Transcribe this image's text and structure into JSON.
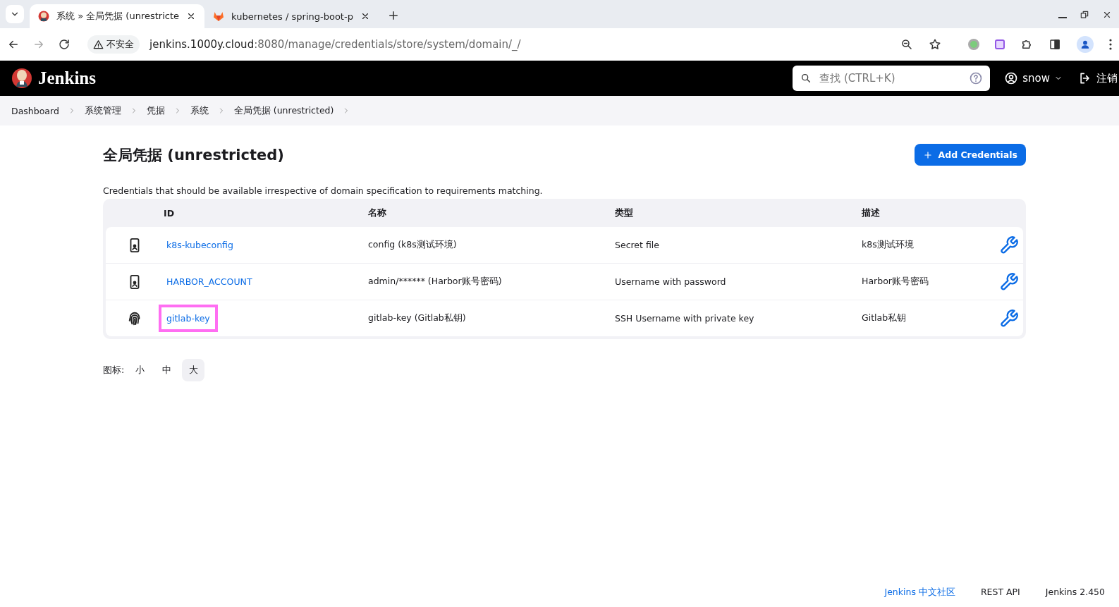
{
  "browser": {
    "tabs": [
      {
        "title": "系统 » 全局凭据 (unrestricte",
        "kind": "jenkins",
        "selected": true
      },
      {
        "title": "kubernetes / spring-boot-p",
        "kind": "gitlab",
        "selected": false
      }
    ],
    "security": "不安全",
    "host": "jenkins.1000y.cloud",
    "path": ":8080/manage/credentials/store/system/domain/_/"
  },
  "header": {
    "brand": "Jenkins",
    "search_placeholder": "查找 (CTRL+K)",
    "user": "snow",
    "logout": "注销"
  },
  "breadcrumbs": [
    "Dashboard",
    "系统管理",
    "凭据",
    "系统",
    "全局凭据 (unrestricted)"
  ],
  "page": {
    "title": "全局凭据 (unrestricted)",
    "add_button": "Add Credentials",
    "description": "Credentials that should be available irrespective of domain specification to requirements matching."
  },
  "table": {
    "columns": [
      "ID",
      "名称",
      "类型",
      "描述"
    ],
    "rows": [
      {
        "kind": "device",
        "id": "k8s-kubeconfig",
        "name": "config (k8s测试环境)",
        "type": "Secret file",
        "description": "k8s测试环境",
        "highlighted": false
      },
      {
        "kind": "device",
        "id": "HARBOR_ACCOUNT",
        "name": "admin/****** (Harbor账号密码)",
        "type": "Username with password",
        "description": "Harbor账号密码",
        "highlighted": false
      },
      {
        "kind": "fingerprint",
        "id": "gitlab-key",
        "name": "gitlab-key (Gitlab私钥)",
        "type": "SSH Username with private key",
        "description": "Gitlab私钥",
        "highlighted": true
      }
    ]
  },
  "icon_size": {
    "label": "图标:",
    "options": [
      {
        "label": "小",
        "selected": false
      },
      {
        "label": "中",
        "selected": false
      },
      {
        "label": "大",
        "selected": true
      }
    ]
  },
  "footer": [
    {
      "label": "Jenkins 中文社区",
      "kind": "link"
    },
    {
      "label": "REST API",
      "kind": "plain"
    },
    {
      "label": "Jenkins 2.450",
      "kind": "plain"
    }
  ]
}
